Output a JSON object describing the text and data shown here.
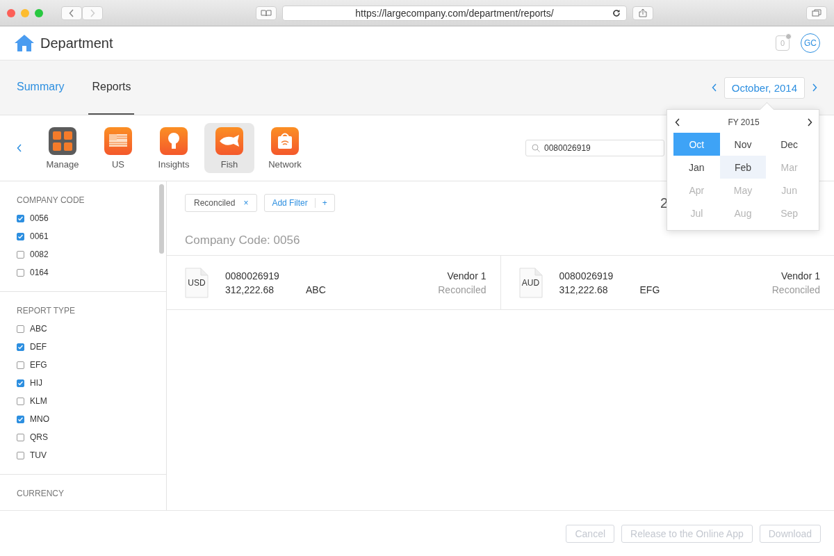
{
  "browser": {
    "url": "https://largecompany.com/department/reports/"
  },
  "header": {
    "title": "Department",
    "notifications": "0",
    "avatar": "GC"
  },
  "nav_tabs": [
    {
      "label": "Summary",
      "selected": false
    },
    {
      "label": "Reports",
      "selected": true
    }
  ],
  "period": {
    "label": "October, 2014"
  },
  "apps": [
    {
      "label": "Manage",
      "kind": "manage",
      "selected": false
    },
    {
      "label": "US",
      "kind": "flag",
      "selected": false
    },
    {
      "label": "Insights",
      "kind": "bulb",
      "selected": false
    },
    {
      "label": "Fish",
      "kind": "fish",
      "selected": true
    },
    {
      "label": "Network",
      "kind": "bag",
      "selected": false
    }
  ],
  "search": {
    "value": "0080026919"
  },
  "sidebar": [
    {
      "title": "COMPANY CODE",
      "items": [
        {
          "label": "0056",
          "checked": true
        },
        {
          "label": "0061",
          "checked": true
        },
        {
          "label": "0082",
          "checked": false
        },
        {
          "label": "0164",
          "checked": false
        }
      ]
    },
    {
      "title": "REPORT TYPE",
      "items": [
        {
          "label": "ABC",
          "checked": false
        },
        {
          "label": "DEF",
          "checked": true
        },
        {
          "label": "EFG",
          "checked": false
        },
        {
          "label": "HIJ",
          "checked": true
        },
        {
          "label": "KLM",
          "checked": false
        },
        {
          "label": "MNO",
          "checked": true
        },
        {
          "label": "QRS",
          "checked": false
        },
        {
          "label": "TUV",
          "checked": false
        }
      ]
    },
    {
      "title": "CURRENCY"
    }
  ],
  "filters": [
    {
      "label": "Reconciled",
      "remove": "×"
    }
  ],
  "add_filter": {
    "label": "Add Filter",
    "plus": "+"
  },
  "count": "2",
  "group_title": "Company Code: 0056",
  "records": [
    {
      "currency": "USD",
      "number": "0080026919",
      "amount": "312,222.68",
      "type": "ABC",
      "vendor": "Vendor 1",
      "status": "Reconciled"
    },
    {
      "currency": "AUD",
      "number": "0080026919",
      "amount": "312,222.68",
      "type": "EFG",
      "vendor": "Vendor 1",
      "status": "Reconciled"
    }
  ],
  "picker": {
    "title": "FY 2015",
    "months": [
      {
        "label": "Oct",
        "selected": true,
        "hovered": false,
        "disabled": false
      },
      {
        "label": "Nov",
        "selected": false,
        "hovered": false,
        "disabled": false
      },
      {
        "label": "Dec",
        "selected": false,
        "hovered": false,
        "disabled": false
      },
      {
        "label": "Jan",
        "selected": false,
        "hovered": false,
        "disabled": false
      },
      {
        "label": "Feb",
        "selected": false,
        "hovered": true,
        "disabled": false
      },
      {
        "label": "Mar",
        "selected": false,
        "hovered": false,
        "disabled": true
      },
      {
        "label": "Apr",
        "selected": false,
        "hovered": false,
        "disabled": true
      },
      {
        "label": "May",
        "selected": false,
        "hovered": false,
        "disabled": true
      },
      {
        "label": "Jun",
        "selected": false,
        "hovered": false,
        "disabled": true
      },
      {
        "label": "Jul",
        "selected": false,
        "hovered": false,
        "disabled": true
      },
      {
        "label": "Aug",
        "selected": false,
        "hovered": false,
        "disabled": true
      },
      {
        "label": "Sep",
        "selected": false,
        "hovered": false,
        "disabled": true
      }
    ]
  },
  "footer_buttons": [
    {
      "label": "Cancel",
      "disabled": true
    },
    {
      "label": "Release to the Online App",
      "disabled": true
    },
    {
      "label": "Download",
      "disabled": true
    }
  ]
}
